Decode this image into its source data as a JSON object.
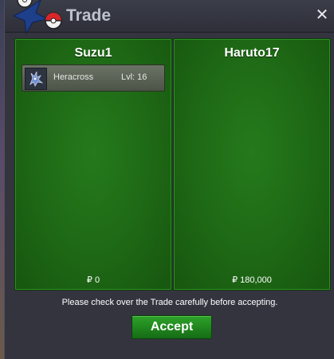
{
  "window": {
    "title": "Trade",
    "close_symbol": "✕"
  },
  "trade": {
    "left": {
      "player_name": "Suzu1",
      "pokemon": [
        {
          "name": "Heracross",
          "level": "Lvl: 16",
          "icon": "heracross-icon"
        }
      ],
      "money": "₽ 0"
    },
    "right": {
      "player_name": "Haruto17",
      "pokemon": [],
      "money": "₽ 180,000"
    }
  },
  "footer": {
    "notice": "Please check over the Trade carefully before accepting.",
    "accept_label": "Accept"
  },
  "colors": {
    "panel_green": "#1e6815",
    "accept_green": "#1f841d",
    "window_bg": "#34343f"
  }
}
